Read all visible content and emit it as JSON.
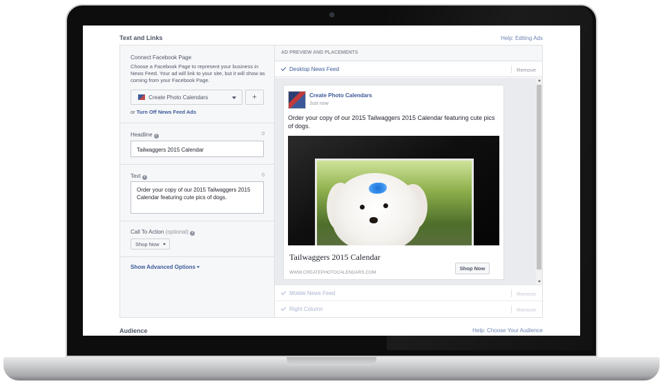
{
  "section_text_links": {
    "title": "Text and Links",
    "help": "Help: Editing Ads"
  },
  "connect_page": {
    "label": "Connect Facebook Page",
    "description": "Choose a Facebook Page to represent your business in News Feed. Your ad will link to your site, but it will show as coming from your Facebook Page.",
    "selected_page": "Create Photo Calendars",
    "add_button": "+",
    "or_text": "or",
    "turn_off_link": "Turn Off News Feed Ads"
  },
  "headline": {
    "label": "Headline",
    "counter": "0",
    "value": "Tailwaggers 2015 Calendar"
  },
  "text_field": {
    "label": "Text",
    "counter": "0",
    "value": "Order your copy of our 2015 Tailwaggers 2015 Calendar featuring cute pics of dogs."
  },
  "call_to_action": {
    "label": "Call To Action",
    "optional": "(optional)",
    "selected": "Shop Now"
  },
  "advanced_options": "Show Advanced Options",
  "preview": {
    "header": "AD PREVIEW AND PLACEMENTS",
    "placements": [
      {
        "label": "Desktop News Feed",
        "remove": "Remove"
      },
      {
        "label": "Mobile News Feed",
        "remove": "Remove"
      },
      {
        "label": "Right Column",
        "remove": "Remove"
      }
    ],
    "card": {
      "page_name": "Create Photo Calendars",
      "timestamp": "Just now",
      "body": "Order your copy of our 2015 Tailwaggers 2015 Calendar featuring cute pics of dogs.",
      "title": "Tailwaggers 2015 Calendar",
      "url": "WWW.CREATEPHOTOCALENDARS.COM",
      "cta": "Shop Now"
    }
  },
  "section_audience": {
    "title": "Audience",
    "help": "Help: Choose Your Audience"
  }
}
